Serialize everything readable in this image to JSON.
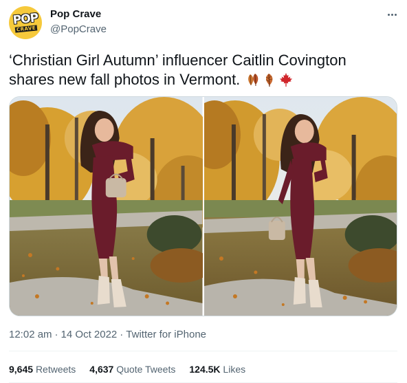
{
  "account": {
    "display_name": "Pop Crave",
    "handle": "@PopCrave",
    "avatar_logo_top": "POP",
    "avatar_logo_bottom": "CRAVE"
  },
  "tweet": {
    "text": "‘Christian Girl Autumn’ influencer Caitlin Covington shares new fall photos in Vermont.",
    "emojis": [
      "fallen-leaf-icon",
      "fallen-leaf-icon",
      "maple-leaf-icon"
    ],
    "photo_count": 2
  },
  "meta": {
    "time": "12:02 am",
    "separator": "·",
    "date": "14 Oct 2022",
    "source": "Twitter for iPhone"
  },
  "stats": {
    "retweets_count": "9,645",
    "retweets_label": "Retweets",
    "quotes_count": "4,637",
    "quotes_label": "Quote Tweets",
    "likes_count": "124.5K",
    "likes_label": "Likes"
  },
  "colors": {
    "text_primary": "#0f1419",
    "text_secondary": "#536471",
    "divider": "#eff3f4",
    "avatar_yellow": "#f6c93b",
    "maple_red": "#d0252b",
    "dress_burgundy": "#6a1c2b"
  }
}
